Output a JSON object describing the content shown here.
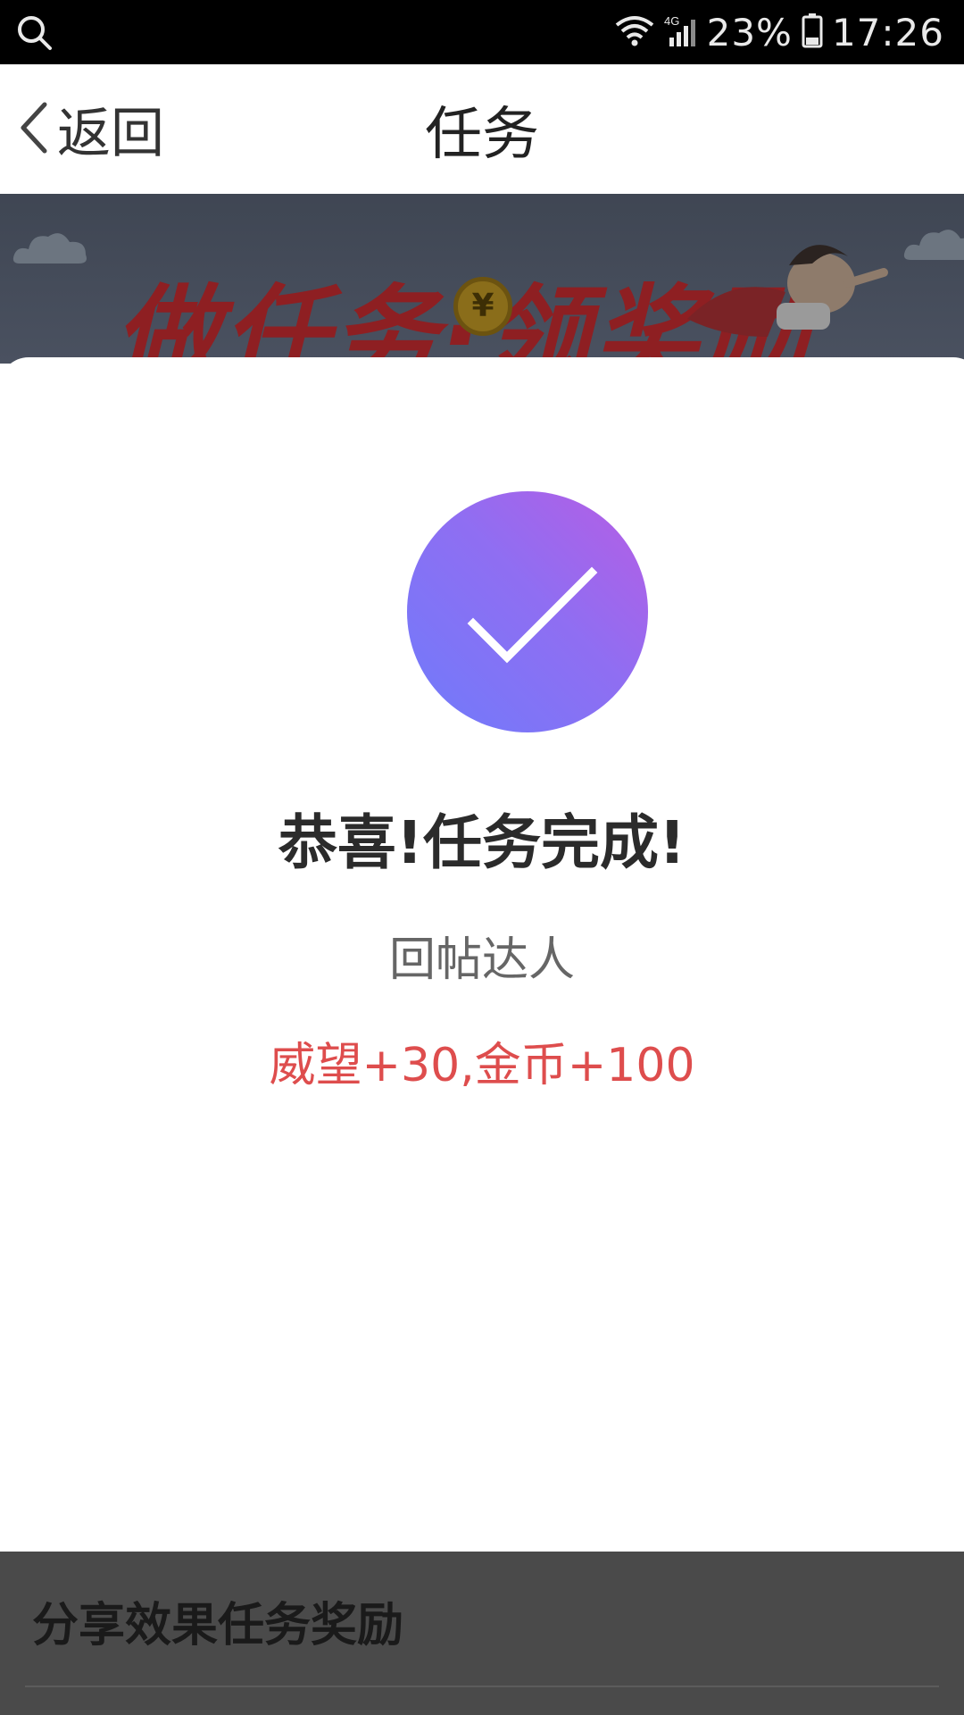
{
  "status_bar": {
    "battery_percent": "23%",
    "time": "17:26",
    "network": "4G",
    "icons": [
      "search-icon",
      "wifi-icon",
      "signal-icon",
      "battery-icon"
    ]
  },
  "nav": {
    "back_label": "返回",
    "title": "任务"
  },
  "banner": {
    "headline": "做任务·领奖励"
  },
  "dialog": {
    "title": "恭喜!任务完成!",
    "task_name": "回帖达人",
    "reward": "威望+30,金币+100",
    "icon": "checkmark-icon",
    "gradient_colors": [
      "#b75de4",
      "#6f7bfb"
    ],
    "reward_color": "#de4d4d"
  },
  "below": {
    "section_title": "分享效果任务奖励"
  }
}
